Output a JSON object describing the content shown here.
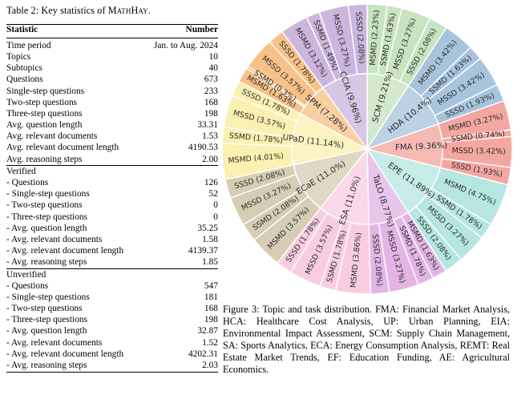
{
  "table": {
    "caption_prefix": "Table 2:",
    "caption_text": "Key statistics of",
    "caption_name": "MathHay",
    "caption_suffix": ".",
    "columns": [
      "Statistic",
      "Number"
    ],
    "sections": [
      {
        "title": null,
        "rows": [
          {
            "label": "Time period",
            "value": "Jan. to Aug. 2024"
          },
          {
            "label": "Topics",
            "value": "10"
          },
          {
            "label": "Subtopics",
            "value": "40"
          },
          {
            "label": "Questions",
            "value": "673"
          },
          {
            "label": "Single-step questions",
            "value": "233"
          },
          {
            "label": "Two-step questions",
            "value": "168"
          },
          {
            "label": "Three-step questions",
            "value": "198"
          },
          {
            "label": "Avg. question length",
            "value": "33.31"
          },
          {
            "label": "Avg. relevant documents",
            "value": "1.53"
          },
          {
            "label": "Avg. relevant document length",
            "value": "4190.53"
          },
          {
            "label": "Avg. reasoning steps",
            "value": "2.00"
          }
        ]
      },
      {
        "title": "Verified",
        "rows": [
          {
            "label": "- Questions",
            "value": "126"
          },
          {
            "label": "- Single-step questions",
            "value": "52"
          },
          {
            "label": "- Two-step questions",
            "value": "0"
          },
          {
            "label": "- Three-step questions",
            "value": "0"
          },
          {
            "label": "- Avg. question length",
            "value": "35.25"
          },
          {
            "label": "- Avg. relevant documents",
            "value": "1.58"
          },
          {
            "label": "- Avg. relevant document length",
            "value": "4139.37"
          },
          {
            "label": "- Avg. reasoning steps",
            "value": "1.85"
          }
        ]
      },
      {
        "title": "Unverified",
        "rows": [
          {
            "label": "- Questions",
            "value": "547"
          },
          {
            "label": "- Single-step questions",
            "value": "181"
          },
          {
            "label": "- Two-step questions",
            "value": "168"
          },
          {
            "label": "- Three-step questions",
            "value": "198"
          },
          {
            "label": "- Avg. question length",
            "value": "32.87"
          },
          {
            "label": "- Avg. relevant documents",
            "value": "1.52"
          },
          {
            "label": "- Avg. relevant document length",
            "value": "4202.31"
          },
          {
            "label": "- Avg. reasoning steps",
            "value": "2.03"
          }
        ]
      }
    ]
  },
  "figure": {
    "caption": "Figure 3: Topic and task distribution. FMA: Financial Market Analysis, HCA: Healthcare Cost Analysis, UP: Urban Planning, EIA: Environmental Impact Assessment, SCM: Supply Chain Management, SA: Sports Analytics, ECA: Energy Consumption Analysis, REMT: Real Estate Market Trends, EF: Education Funding, AE: Agricultural Economics."
  },
  "chart_data": {
    "type": "pie",
    "title": "Topic and task distribution",
    "layout": "sunburst",
    "rings": 2,
    "start_angle_deg": -90,
    "direction": "clockwise",
    "inner_radius_frac": 0.0,
    "ring_split_frac": 0.52,
    "segments": [
      {
        "label": "SCM",
        "value": 9.21,
        "display": "SCM (9.21%)",
        "color": "#c7e3c0",
        "children": [
          {
            "label": "MSMD",
            "value": 2.23,
            "display": "MSMD (2.23%)"
          },
          {
            "label": "SSMD",
            "value": 1.63,
            "display": "SSMD (1.63%)"
          },
          {
            "label": "MSSD",
            "value": 3.27,
            "display": "MSSD (3.27%)"
          },
          {
            "label": "SSSD",
            "value": 2.08,
            "display": "SSSD (2.08%)"
          }
        ]
      },
      {
        "label": "HDA",
        "value": 10.4,
        "display": "HDA (10.4%)",
        "color": "#a8c4dd",
        "children": [
          {
            "label": "MSMD",
            "value": 3.42,
            "display": "MSMD (3.42%)"
          },
          {
            "label": "SSMD",
            "value": 1.63,
            "display": "SSMD (1.63%)"
          },
          {
            "label": "MSSD",
            "value": 3.42,
            "display": "MSSD (3.42%)"
          },
          {
            "label": "SSSD",
            "value": 1.93,
            "display": "SSSD (1.93%)"
          }
        ]
      },
      {
        "label": "FMA",
        "value": 9.36,
        "display": "FMA (9.36%)",
        "color": "#f4a7a0",
        "children": [
          {
            "label": "MSMD",
            "value": 3.27,
            "display": "MSMD (3.27%)"
          },
          {
            "label": "SSMD",
            "value": 0.74,
            "display": "SSMD (0.74%)"
          },
          {
            "label": "MSSD",
            "value": 3.42,
            "display": "MSSD (3.42%)"
          },
          {
            "label": "SSSD",
            "value": 1.93,
            "display": "SSSD (1.93%)"
          }
        ]
      },
      {
        "label": "EPE",
        "value": 11.89,
        "display": "EPE (11.89%)",
        "color": "#b6e6e0",
        "children": [
          {
            "label": "MSMD",
            "value": 4.75,
            "display": "MSMD (4.75%)"
          },
          {
            "label": "SSMD",
            "value": 1.78,
            "display": "SSMD (1.78%)"
          },
          {
            "label": "MSSD",
            "value": 3.27,
            "display": "MSSD (3.27%)"
          },
          {
            "label": "SSSD",
            "value": 2.08,
            "display": "SSSD (2.08%)"
          }
        ]
      },
      {
        "label": "TaLO",
        "value": 8.77,
        "display": "TaLO (8.77%)",
        "color": "#e2b5e4",
        "children": [
          {
            "label": "MSMD",
            "value": 1.63,
            "display": "MSMD (1.63%)"
          },
          {
            "label": "SSMD",
            "value": 1.78,
            "display": "SSMD (1.78%)"
          },
          {
            "label": "MSSD",
            "value": 3.27,
            "display": "MSSD (3.27%)"
          },
          {
            "label": "SSSD",
            "value": 2.08,
            "display": "SSSD (2.08%)"
          }
        ]
      },
      {
        "label": "ESA",
        "value": 11.0,
        "display": "ESA (11.0%)",
        "color": "#f8cde0",
        "children": [
          {
            "label": "MSMD",
            "value": 3.86,
            "display": "MSMD (3.86%)"
          },
          {
            "label": "SSMD",
            "value": 1.78,
            "display": "SSMD (1.78%)"
          },
          {
            "label": "MSSD",
            "value": 3.57,
            "display": "MSSD (3.57%)"
          },
          {
            "label": "SSSD",
            "value": 1.78,
            "display": "SSSD (1.78%)"
          }
        ]
      },
      {
        "label": "ECaE",
        "value": 11.0,
        "display": "ECaE (11.0%)",
        "color": "#d6cdb4",
        "children": [
          {
            "label": "MSMD",
            "value": 3.57,
            "display": "MSMD (3.57%)"
          },
          {
            "label": "SSMD",
            "value": 2.08,
            "display": "SSMD (2.08%)"
          },
          {
            "label": "MSSD",
            "value": 3.27,
            "display": "MSSD (3.27%)"
          },
          {
            "label": "SSSD",
            "value": 2.08,
            "display": "SSSD (2.08%)"
          }
        ]
      },
      {
        "label": "UPaD",
        "value": 11.14,
        "display": "UPaD (11.14%)",
        "color": "#faf0b0",
        "children": [
          {
            "label": "MSMD",
            "value": 4.01,
            "display": "MSMD (4.01%)"
          },
          {
            "label": "SSMD",
            "value": 1.78,
            "display": "SSMD (1.78%)"
          },
          {
            "label": "MSSD",
            "value": 3.57,
            "display": "MSSD (3.57%)"
          },
          {
            "label": "SSSD",
            "value": 1.78,
            "display": "SSSD (1.78%)"
          }
        ]
      },
      {
        "label": "SPM",
        "value": 7.28,
        "display": "SPM (7.28%)",
        "color": "#f6c289",
        "children": [
          {
            "label": "MSMD",
            "value": 1.63,
            "display": "MSMD (1.63%)"
          },
          {
            "label": "SSMD",
            "value": 0.3,
            "display": "SSMD (0.3%)"
          },
          {
            "label": "MSSD",
            "value": 3.57,
            "display": "MSSD (3.57%)"
          },
          {
            "label": "SSSD",
            "value": 1.78,
            "display": "SSSD (1.78%)"
          }
        ]
      },
      {
        "label": "CCIA",
        "value": 9.96,
        "display": "CCIA (9.96%)",
        "color": "#ccb6dd",
        "children": [
          {
            "label": "MSMD",
            "value": 3.12,
            "display": "MSMD (3.12%)"
          },
          {
            "label": "SSMD",
            "value": 1.49,
            "display": "SSMD (1.49%)"
          },
          {
            "label": "MSSD",
            "value": 3.27,
            "display": "MSSD (3.27%)"
          },
          {
            "label": "SSSD",
            "value": 2.08,
            "display": "SSSD (2.08%)"
          }
        ]
      }
    ]
  }
}
